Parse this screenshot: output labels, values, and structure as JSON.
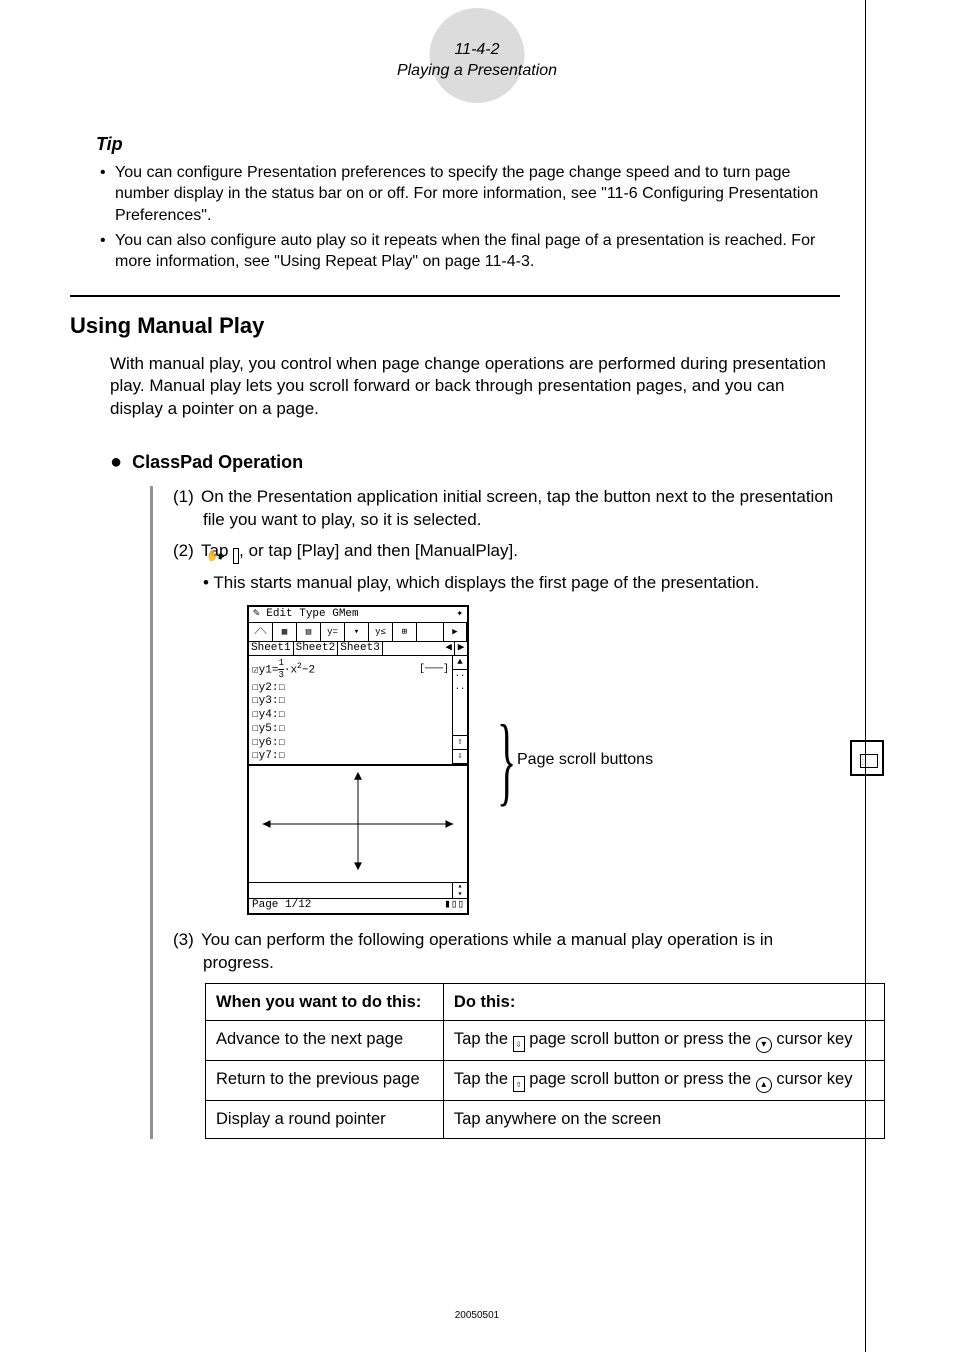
{
  "header": {
    "page_ref": "11-4-2",
    "page_title": "Playing a Presentation"
  },
  "tip": {
    "label": "Tip",
    "items": [
      "You can configure Presentation preferences to specify the page change speed and to turn page number display in the status bar on or off. For more information, see \"11-6 Configuring Presentation Preferences\".",
      "You can also configure auto play so it repeats when the final page of a presentation is reached. For more information, see \"Using Repeat Play\" on page 11-4-3."
    ]
  },
  "section": {
    "heading": "Using Manual Play",
    "intro": "With manual play, you control when page change operations are performed during presentation play. Manual play lets you scroll forward or back through presentation pages, and you can display a pointer on a page."
  },
  "operation": {
    "heading": "ClassPad Operation",
    "steps": {
      "s1": "On the Presentation application initial screen, tap the button next to the presentation file you want to play, so it is selected.",
      "s2a": "Tap ",
      "s2b": ", or tap [Play] and then [ManualPlay].",
      "s2_bullet": "This starts manual play, which displays the first page of the presentation.",
      "s3": "You can perform the following operations while a manual play operation is in progress."
    },
    "numbers": {
      "n1": "(1)",
      "n2": "(2)",
      "n3": "(3)"
    }
  },
  "screenshot": {
    "menubar_left": "✎ Edit Type GMem",
    "menubar_right": "✦",
    "tabs": {
      "t1": "Sheet1",
      "t2": "Sheet2",
      "t3": "Sheet3"
    },
    "expr": "☑y1= (1/3)·x²−2",
    "y_rows": [
      "☐y2:☐",
      "☐y3:☐",
      "☐y4:☐",
      "☐y5:☐",
      "☐y6:☐",
      "☐y7:☐"
    ],
    "status_left": "Page 1/12",
    "scroll_label": "Page scroll buttons"
  },
  "table": {
    "headers": {
      "c1": "When you want to do this:",
      "c2": "Do this:"
    },
    "rows": [
      {
        "c1": "Advance to the next page",
        "c2a": "Tap the ",
        "c2b": " page scroll button or press the ",
        "c2c": " cursor key"
      },
      {
        "c1": "Return to the previous page",
        "c2a": "Tap the ",
        "c2b": " page scroll button or press the ",
        "c2c": " cursor key"
      },
      {
        "c1": "Display a round pointer",
        "c2": "Tap anywhere on the screen"
      }
    ]
  },
  "footer_code": "20050501"
}
